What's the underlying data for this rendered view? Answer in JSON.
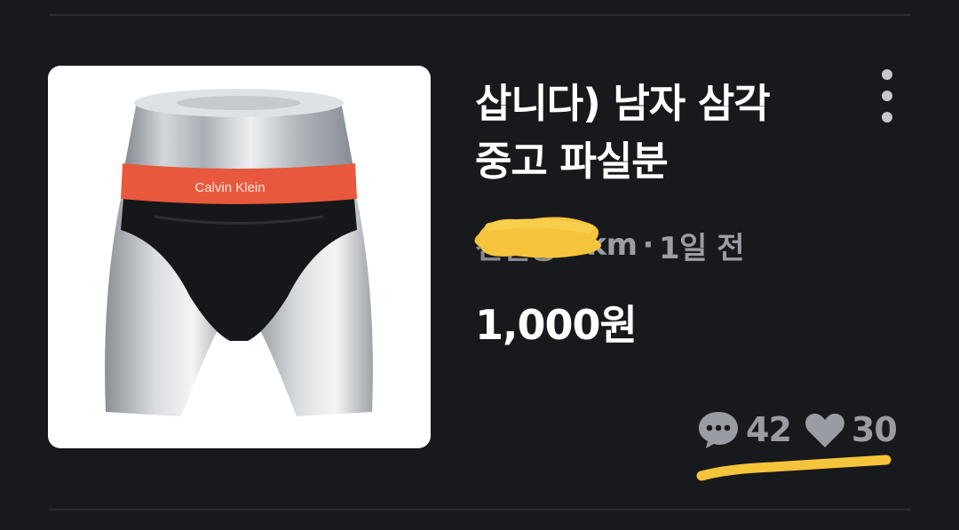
{
  "listing": {
    "title_line1": "삽니다) 남자 삼각",
    "title_line2": "중고 파실분",
    "location": "신길동",
    "distance": "3km",
    "separator": "·",
    "time_ago": "1일 전",
    "price": "1,000원",
    "chat_count": "42",
    "like_count": "30",
    "product_image_text": "Calvin Klein"
  },
  "icons": {
    "more": "more-vertical-icon",
    "chat": "chat-bubble-icon",
    "like": "heart-icon"
  },
  "colors": {
    "background": "#18191d",
    "divider": "#2a2c31",
    "title": "#ffffff",
    "meta": "#9c9ea5",
    "stats": "#9a9ca3",
    "highlighter": "#f6c43a",
    "waistband": "#e8583c"
  }
}
